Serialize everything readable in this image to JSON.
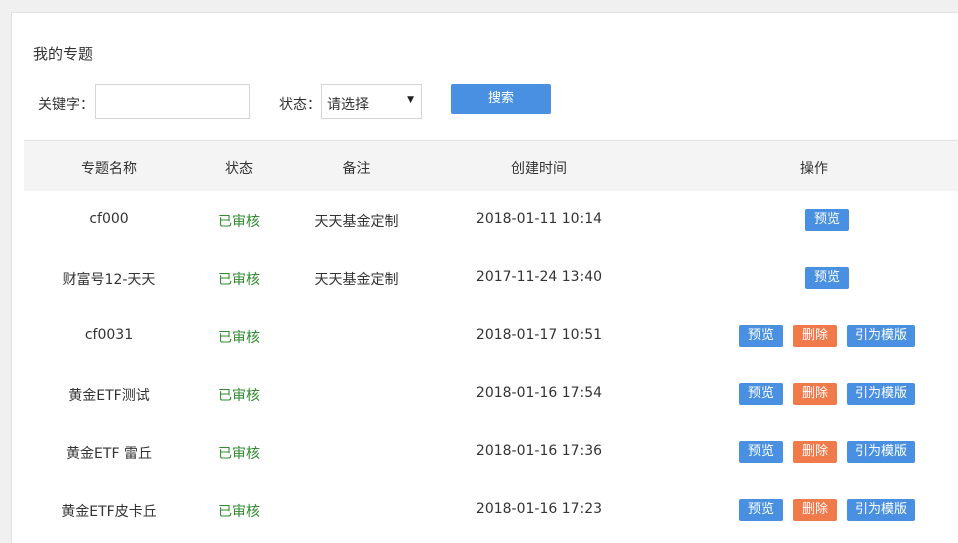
{
  "page_title": "我的专题",
  "search": {
    "keyword_label": "关键字：",
    "keyword_value": "",
    "status_label": "状态：",
    "status_selected": "请选择",
    "search_label": "搜索"
  },
  "table": {
    "headers": {
      "name": "专题名称",
      "status": "状态",
      "note": "备注",
      "created": "创建时间",
      "ops": "操作"
    },
    "rows": [
      {
        "name": "cf000",
        "status": "已审核",
        "note": "天天基金定制",
        "created": "2018-01-11 10:14",
        "actions": [
          "预览"
        ]
      },
      {
        "name": "财富号12-天天",
        "status": "已审核",
        "note": "天天基金定制",
        "created": "2017-11-24 13:40",
        "actions": [
          "预览"
        ]
      },
      {
        "name": "cf0031",
        "status": "已审核",
        "note": "",
        "created": "2018-01-17 10:51",
        "actions": [
          "预览",
          "删除",
          "引为模版"
        ]
      },
      {
        "name": "黄金ETF测试",
        "status": "已审核",
        "note": "",
        "created": "2018-01-16 17:54",
        "actions": [
          "预览",
          "删除",
          "引为模版"
        ]
      },
      {
        "name": "黄金ETF 雷丘",
        "status": "已审核",
        "note": "",
        "created": "2018-01-16 17:36",
        "actions": [
          "预览",
          "删除",
          "引为模版"
        ]
      },
      {
        "name": "黄金ETF皮卡丘",
        "status": "已审核",
        "note": "",
        "created": "2018-01-16 17:23",
        "actions": [
          "预览",
          "删除",
          "引为模版"
        ]
      }
    ]
  },
  "colors": {
    "primary": "#4a90e2",
    "danger": "#f07a4a",
    "approved": "#2e8b2e"
  }
}
